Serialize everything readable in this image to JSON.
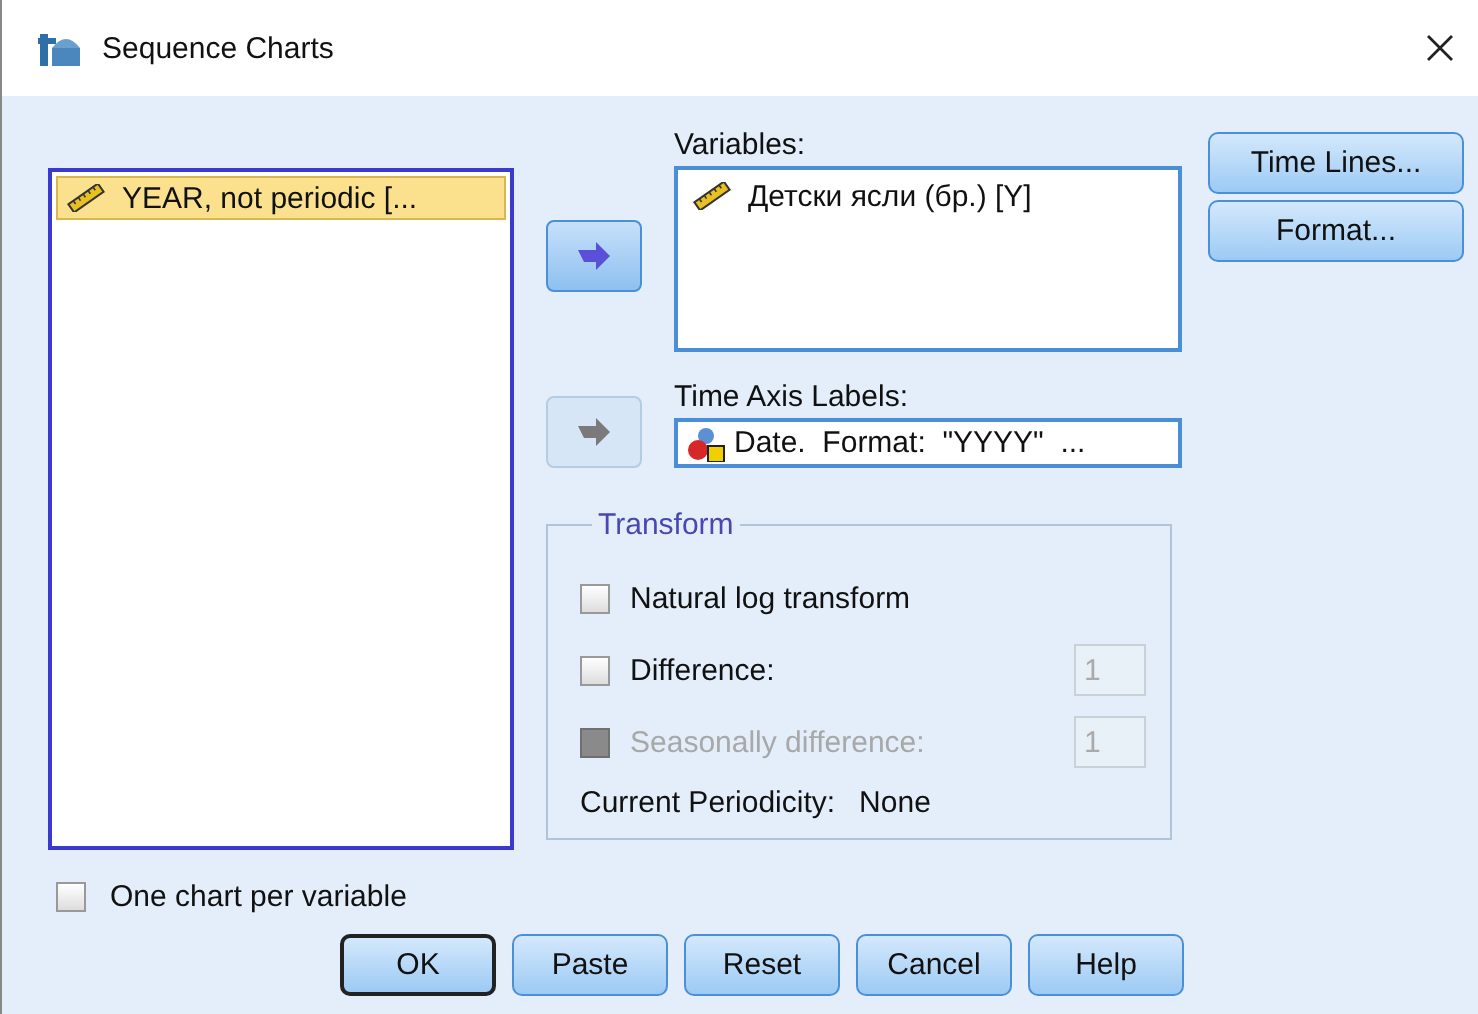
{
  "window": {
    "title": "Sequence Charts"
  },
  "source_list": {
    "items": [
      {
        "label": "YEAR, not periodic [...",
        "selected": true
      }
    ]
  },
  "variables": {
    "label": "Variables:",
    "move_disabled": false,
    "items": [
      {
        "label": "Детски ясли (бр.) [Y]",
        "selected": false
      }
    ]
  },
  "time_axis_labels": {
    "label": "Time Axis Labels:",
    "value": "Date.  Format:  \"YYYY\"  ...",
    "move_disabled": true
  },
  "side_buttons": [
    "Time Lines...",
    "Format..."
  ],
  "transform": {
    "title": "Transform",
    "options": [
      {
        "label": "Natural log transform",
        "checked": false,
        "disabled": false
      },
      {
        "label": "Difference:",
        "checked": false,
        "disabled": false,
        "value": "1"
      },
      {
        "label": "Seasonally difference:",
        "checked": false,
        "disabled": true,
        "value": "1"
      }
    ],
    "periodicity_label": "Current Periodicity:",
    "periodicity": "None"
  },
  "one_chart_per_variable": {
    "label": "One chart per variable",
    "checked": false
  },
  "buttons": [
    {
      "label": "OK",
      "default": true
    },
    {
      "label": "Paste",
      "default": false
    },
    {
      "label": "Reset",
      "default": false
    },
    {
      "label": "Cancel",
      "default": false
    },
    {
      "label": "Help",
      "default": false
    }
  ]
}
